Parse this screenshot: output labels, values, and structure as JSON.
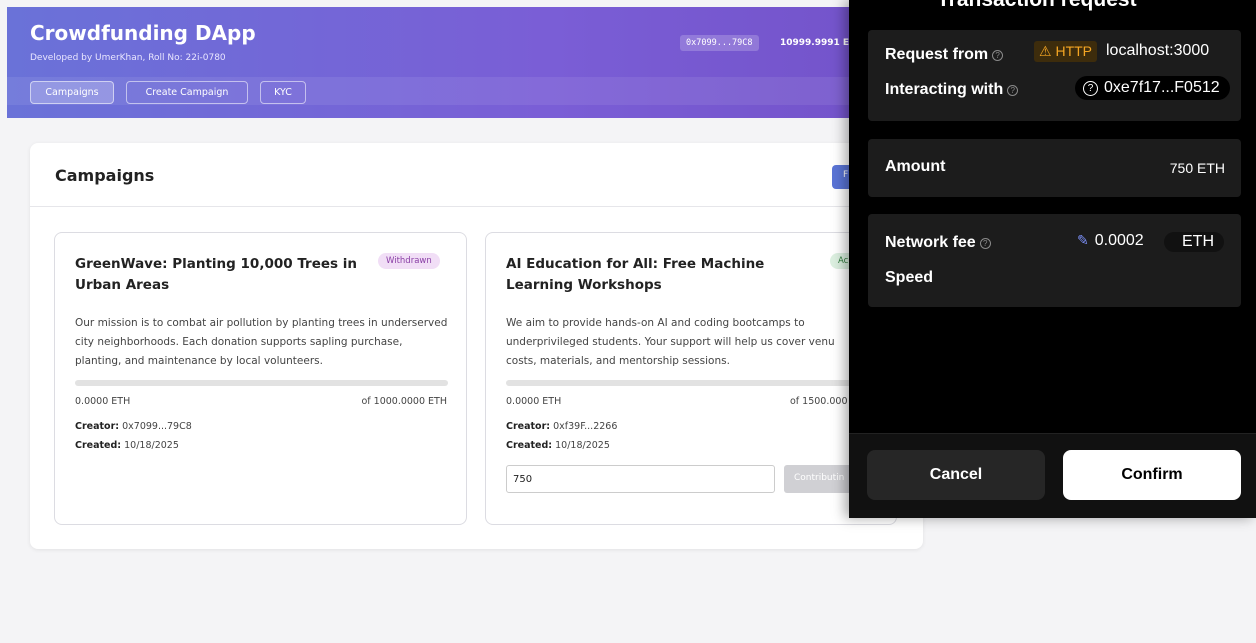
{
  "app": {
    "title": "Crowdfunding DApp",
    "subtitle": "Developed by UmerKhan, Roll No: 22i-0780",
    "account_address": "0x7099...79C8",
    "account_balance": "10999.9991 ET",
    "nav": [
      {
        "label": "Campaigns",
        "active": true
      },
      {
        "label": "Create Campaign",
        "active": false
      },
      {
        "label": "KYC",
        "active": false
      }
    ]
  },
  "campaigns_panel": {
    "title": "Campaigns",
    "button_partial": "F"
  },
  "campaigns": [
    {
      "title": "GreenWave: Planting 10,000 Trees in Urban Areas",
      "status": "Withdrawn",
      "description": "Our mission is to combat air pollution by planting trees in underserved city neighborhoods. Each donation supports sapling purchase, planting, and maintenance by local volunteers.",
      "raised": "0.0000 ETH",
      "goal": "of 1000.0000 ETH",
      "progress": 0,
      "creator_label": "Creator:",
      "creator": "0x7099...79C8",
      "created_label": "Created:",
      "created": "10/18/2025"
    },
    {
      "title": "AI Education for All: Free Machine Learning Workshops",
      "status": "Ac",
      "description": "We aim to provide hands-on AI and coding bootcamps to underprivileged students. Your support will help us cover venu costs, materials, and mentorship sessions.",
      "raised": "0.0000 ETH",
      "goal": "of 1500.000",
      "progress": 0,
      "creator_label": "Creator:",
      "creator": "0xf39F...2266",
      "created_label": "Created:",
      "created": "10/18/2025",
      "amount_input_value": "750",
      "contribute_label": "Contributin"
    }
  ],
  "wallet": {
    "title": "Transaction request",
    "request_from_label": "Request from",
    "http_label": "HTTP",
    "host": "localhost:3000",
    "interacting_label": "Interacting with",
    "contract": "0xe7f17...F0512",
    "amount_label": "Amount",
    "amount_value": "750 ETH",
    "network_fee_label": "Network fee",
    "network_fee_value": "0.0002",
    "fee_currency": "ETH",
    "speed_label": "Speed",
    "cancel_label": "Cancel",
    "confirm_label": "Confirm"
  }
}
